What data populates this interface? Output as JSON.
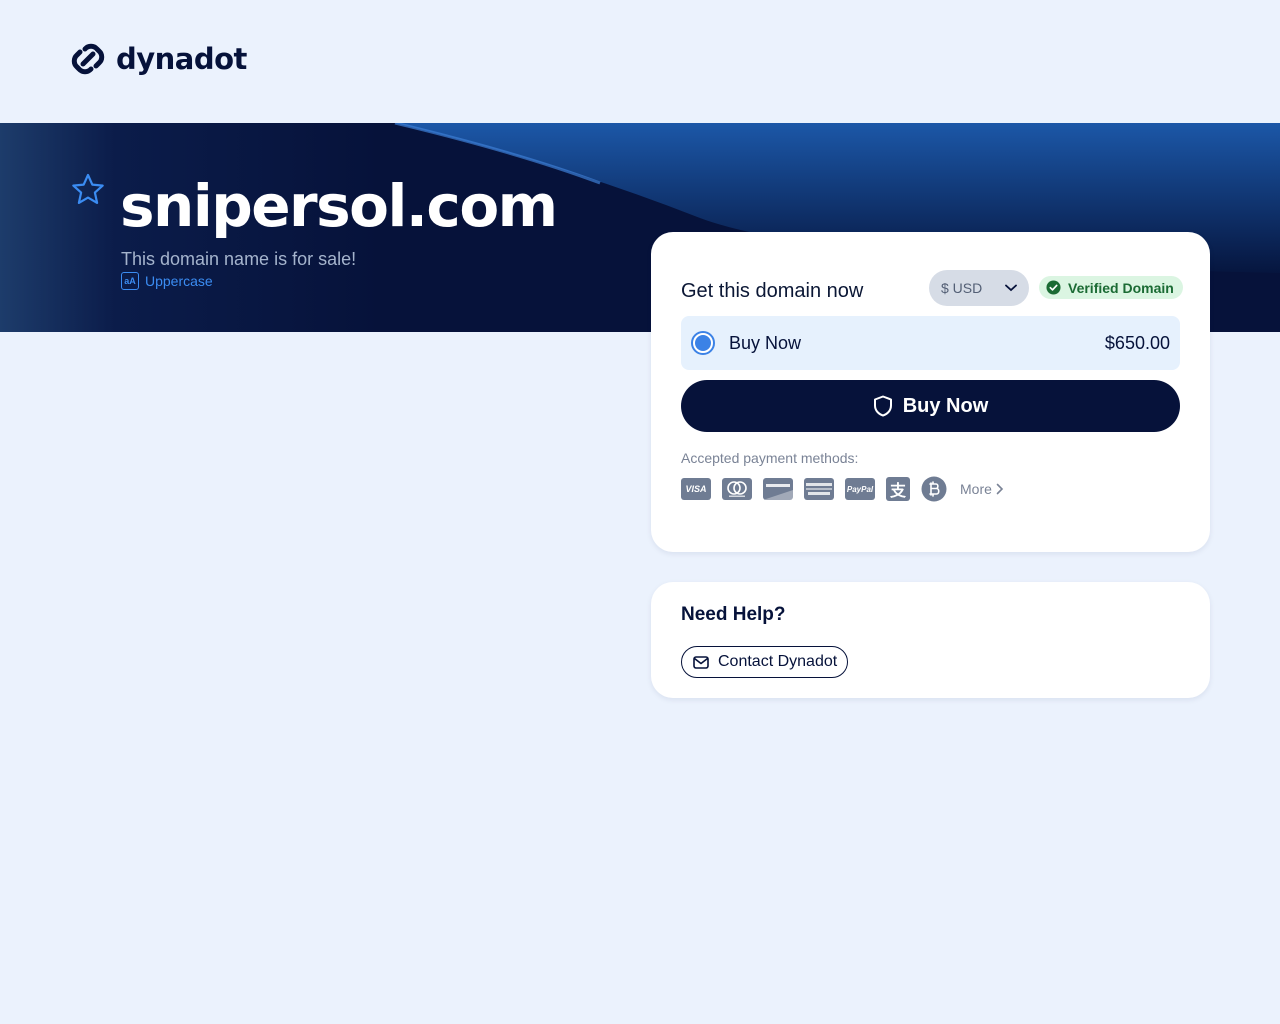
{
  "brand": {
    "name": "dynadot",
    "icon": "chain-link-icon"
  },
  "hero": {
    "domain": "snipersol.com",
    "subtitle": "This domain name is for sale!",
    "uppercase_label": "Uppercase",
    "uppercase_icon_text": "aA"
  },
  "purchase": {
    "title": "Get this domain now",
    "currency": "$ USD",
    "verified_label": "Verified Domain",
    "option": {
      "label": "Buy Now",
      "price": "$650.00",
      "selected": true
    },
    "buy_button_label": "Buy Now",
    "payment_label": "Accepted payment methods:",
    "payment_methods": [
      "visa-icon",
      "mastercard-icon",
      "discover-icon",
      "amex-icon",
      "paypal-icon",
      "alipay-icon",
      "bitcoin-icon"
    ],
    "payment_texts": {
      "visa": "VISA",
      "paypal": "PayPal",
      "alipay": "支"
    },
    "more_label": "More"
  },
  "help": {
    "title": "Need Help?",
    "contact_label": "Contact Dynadot"
  },
  "colors": {
    "page_bg": "#ebf2fd",
    "navy": "#06123a",
    "accent_blue": "#3b82e6",
    "verified_bg": "#dbf5e2",
    "verified_text": "#1b6b34"
  }
}
